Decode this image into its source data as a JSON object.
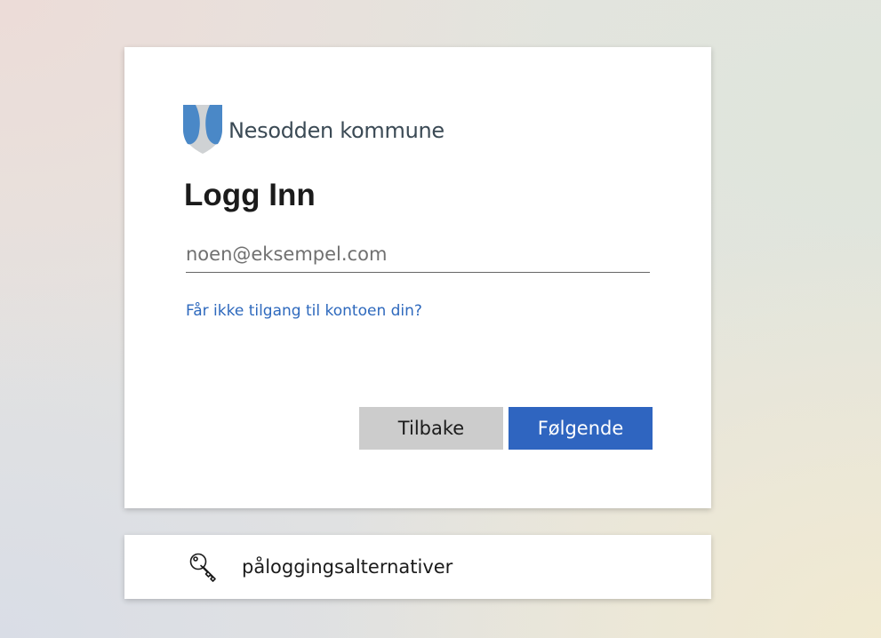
{
  "brand": {
    "name": "Nesodden kommune",
    "shield_primary": "#4a88c7",
    "shield_secondary": "#cfd2d4"
  },
  "signin": {
    "title": "Logg Inn",
    "email_placeholder": "noen@eksempel.com",
    "email_value": "",
    "help_link": "Får ikke tilgang til kontoen din?",
    "back_label": "Tilbake",
    "next_label": "Følgende"
  },
  "options": {
    "label": "påloggingsalternativer",
    "icon": "key-icon"
  },
  "colors": {
    "accent": "#2f65c0",
    "link": "#2e69bd",
    "secondary_button": "#cccccc"
  }
}
